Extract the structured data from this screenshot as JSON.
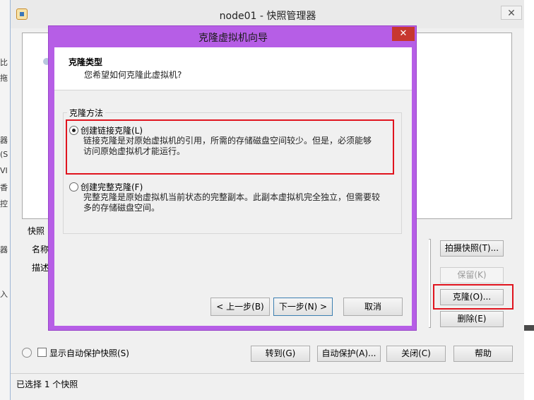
{
  "background_app": {
    "fragments": [
      "比",
      "拖",
      "器",
      "(S",
      "VI",
      "香",
      "控",
      "器",
      "入"
    ]
  },
  "snapshot_manager": {
    "title": "node01 - 快照管理器",
    "close_label": "✕",
    "detail_group_label": "快照",
    "name_label": "名称",
    "description_label": "描述",
    "take_snapshot_button": "拍摄快照(T)...",
    "keep_button": "保留(K)",
    "clone_button": "克隆(O)...",
    "delete_button": "删除(E)",
    "show_autoprotect_label": "显示自动保护快照(S)",
    "show_autoprotect_checked": false,
    "goto_button": "转到(G)",
    "autoprotect_button": "自动保护(A)...",
    "close_button": "关闭(C)",
    "help_button": "帮助",
    "status_text": "已选择 1 个快照"
  },
  "clone_wizard": {
    "title": "克隆虚拟机向导",
    "close_label": "✕",
    "header_title": "克隆类型",
    "header_subtitle": "您希望如何克隆此虚拟机?",
    "group_label": "克隆方法",
    "option_linked": {
      "label": "创建链接克隆(L)",
      "desc_line1": "链接克隆是对原始虚拟机的引用，所需的存储磁盘空间较少。但是，必须能够",
      "desc_line2": "访问原始虚拟机才能运行。",
      "selected": true
    },
    "option_full": {
      "label": "创建完整克隆(F)",
      "desc_line1": "完整克隆是原始虚拟机当前状态的完整副本。此副本虚拟机完全独立，但需要较",
      "desc_line2": "多的存储磁盘空间。",
      "selected": false
    },
    "back_button": "< 上一步(B)",
    "next_button": "下一步(N) >",
    "cancel_button": "取消"
  },
  "colors": {
    "wizard_frame": "#b65ee6",
    "wizard_close": "#c7372f",
    "annotation_red": "#e0141e"
  }
}
